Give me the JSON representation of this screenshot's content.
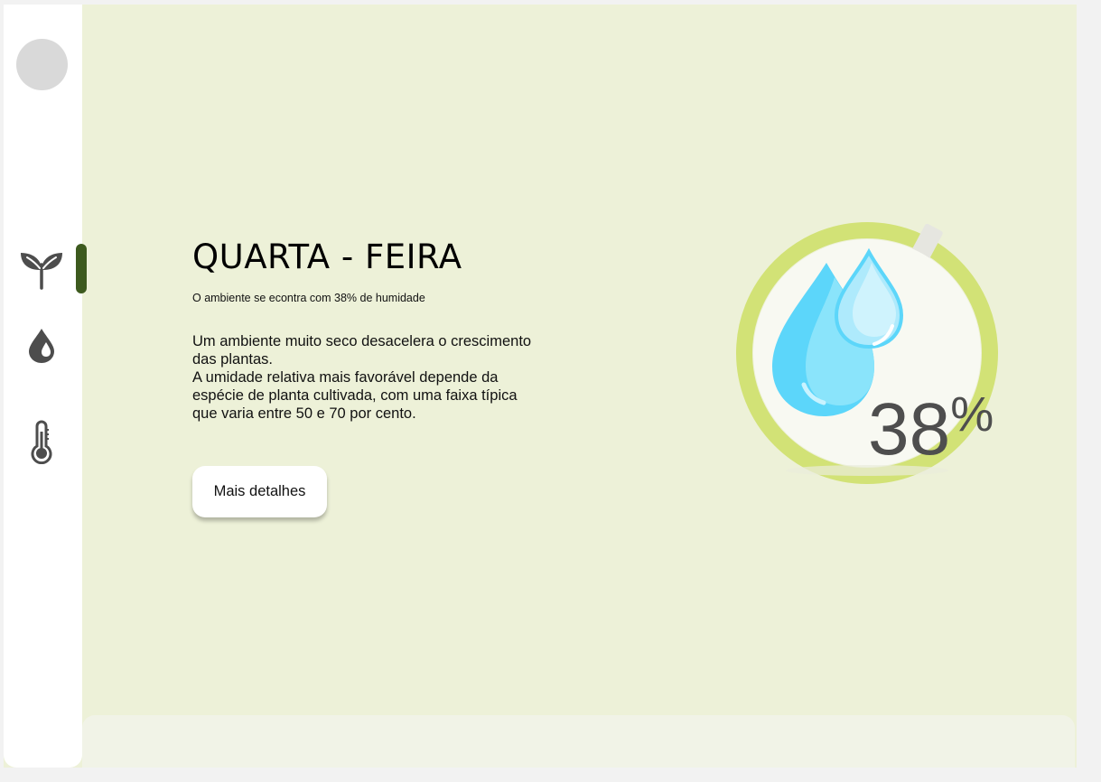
{
  "nav": {
    "items": [
      {
        "id": "plants",
        "icon": "sprout-icon",
        "active": true
      },
      {
        "id": "humidity",
        "icon": "water-drop-icon",
        "active": false
      },
      {
        "id": "temperature",
        "icon": "thermometer-icon",
        "active": false
      }
    ],
    "accent_color": "#3d5a1e",
    "icon_color": "#4d4d4d"
  },
  "main": {
    "day_title": "QUARTA - FEIRA",
    "status_text": "O ambiente se econtra com 38% de humidade",
    "description_lines": [
      "Um ambiente muito seco desacelera o crescimento das plantas.",
      "A umidade relativa mais favorável depende da espécie de planta cultivada, com uma faixa típica que varia entre 50 e 70 por cento."
    ],
    "details_button_label": "Mais detalhes"
  },
  "gauge": {
    "value": 38,
    "unit": "%",
    "value_text": "38",
    "ring_color": "#d2e276",
    "face_color": "#f8f9f2"
  },
  "colors": {
    "background": "#edf1d8",
    "sidebar": "#ffffff",
    "bottom_panel": "#f1f3e7"
  }
}
